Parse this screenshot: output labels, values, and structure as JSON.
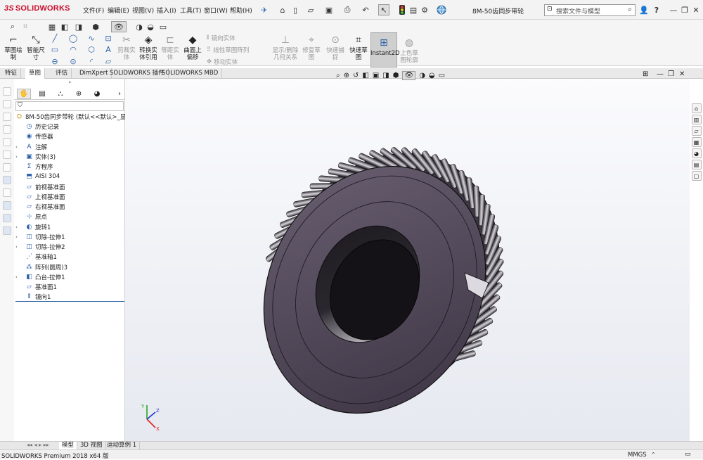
{
  "app": {
    "logo_prefix": "3S",
    "logo_name": "SOLIDWORKS",
    "doc_title": "8M-50齿同步带轮"
  },
  "menu": [
    "文件(F)",
    "编辑(E)",
    "视图(V)",
    "插入(I)",
    "工具(T)",
    "窗口(W)",
    "帮助(H)"
  ],
  "search": {
    "placeholder": "搜索文件与模型"
  },
  "window_controls": {
    "minimize": "—",
    "restore": "❐",
    "close": "✕",
    "help": "?"
  },
  "commands": {
    "sketch": "草图绘制",
    "smart_dim": "智能尺寸",
    "trim": "剪裁实体",
    "convert": "转换实体引用",
    "offset": "等距实体",
    "surface_offset": "曲面上偏移",
    "mirror": "镜向实体",
    "linear_pattern": "线性草图阵列",
    "move": "移动实体",
    "display_delete": "显示/删除几何关系",
    "repair": "修复草图",
    "quick_snap": "快速捕捉",
    "rapid_sketch": "快速草图",
    "instant2d": "Instant2D",
    "shaded_contour": "上色草图轮廓"
  },
  "tabs": [
    "特征",
    "草图",
    "评估",
    "DimXpert",
    "SOLIDWORKS 插件",
    "SOLIDWORKS MBD"
  ],
  "active_tab": "草图",
  "tree": {
    "root": "8M-50齿同步带轮 (默认<<默认>_显示状",
    "items": [
      {
        "label": "历史记录",
        "icon": "history-icon",
        "expand": ""
      },
      {
        "label": "传感器",
        "icon": "sensor-icon",
        "expand": ""
      },
      {
        "label": "注解",
        "icon": "annotation-icon",
        "expand": "›"
      },
      {
        "label": "实体(3)",
        "icon": "solid-bodies-icon",
        "expand": "›"
      },
      {
        "label": "方程序",
        "icon": "equation-icon",
        "expand": ""
      },
      {
        "label": "AISI 304",
        "icon": "material-icon",
        "expand": ""
      },
      {
        "label": "前视基准面",
        "icon": "plane-icon",
        "expand": ""
      },
      {
        "label": "上视基准面",
        "icon": "plane-icon",
        "expand": ""
      },
      {
        "label": "右视基准面",
        "icon": "plane-icon",
        "expand": ""
      },
      {
        "label": "原点",
        "icon": "origin-icon",
        "expand": ""
      },
      {
        "label": "旋转1",
        "icon": "revolve-icon",
        "expand": "›"
      },
      {
        "label": "切除-拉伸1",
        "icon": "cut-extrude-icon",
        "expand": "›"
      },
      {
        "label": "切除-拉伸2",
        "icon": "cut-extrude-icon",
        "expand": "›"
      },
      {
        "label": "基准轴1",
        "icon": "axis-icon",
        "expand": ""
      },
      {
        "label": "阵列(圆周)3",
        "icon": "circular-pattern-icon",
        "expand": ""
      },
      {
        "label": "凸台-拉伸1",
        "icon": "boss-extrude-icon",
        "expand": "›"
      },
      {
        "label": "基准面1",
        "icon": "plane-icon",
        "expand": ""
      },
      {
        "label": "镜向1",
        "icon": "mirror-icon",
        "expand": ""
      }
    ]
  },
  "bottom_tabs": [
    "模型",
    "3D 视图",
    "运动算例 1"
  ],
  "active_bottom_tab": "模型",
  "status": {
    "left": "SOLIDWORKS Premium 2018 x64 版",
    "units": "MMGS"
  },
  "triad": {
    "x": "X",
    "y": "Y",
    "z": "Z"
  },
  "colors": {
    "brand": "#c8102e",
    "pulley": "#4a4050",
    "viewport_bg": "#eef0f5"
  }
}
